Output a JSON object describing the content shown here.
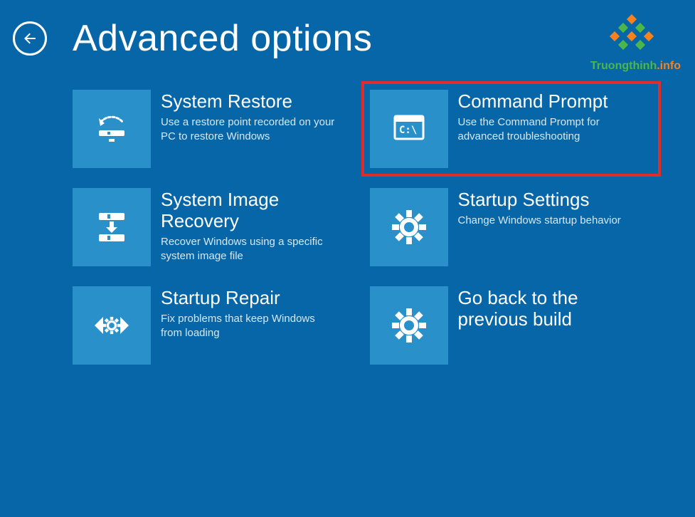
{
  "header": {
    "title": "Advanced options"
  },
  "watermark": {
    "text1": "Truongthinh",
    "dot": ".",
    "text2": "info"
  },
  "options": [
    {
      "title": "System Restore",
      "desc": "Use a restore point recorded on your PC to restore Windows",
      "highlighted": false
    },
    {
      "title": "Command Prompt",
      "desc": "Use the Command Prompt for advanced troubleshooting",
      "highlighted": true
    },
    {
      "title": "System Image Recovery",
      "desc": "Recover Windows using a specific system image file",
      "highlighted": false
    },
    {
      "title": "Startup Settings",
      "desc": "Change Windows startup behavior",
      "highlighted": false
    },
    {
      "title": "Startup Repair",
      "desc": "Fix problems that keep Windows from loading",
      "highlighted": false
    },
    {
      "title": "Go back to the previous build",
      "desc": "",
      "highlighted": false
    }
  ]
}
